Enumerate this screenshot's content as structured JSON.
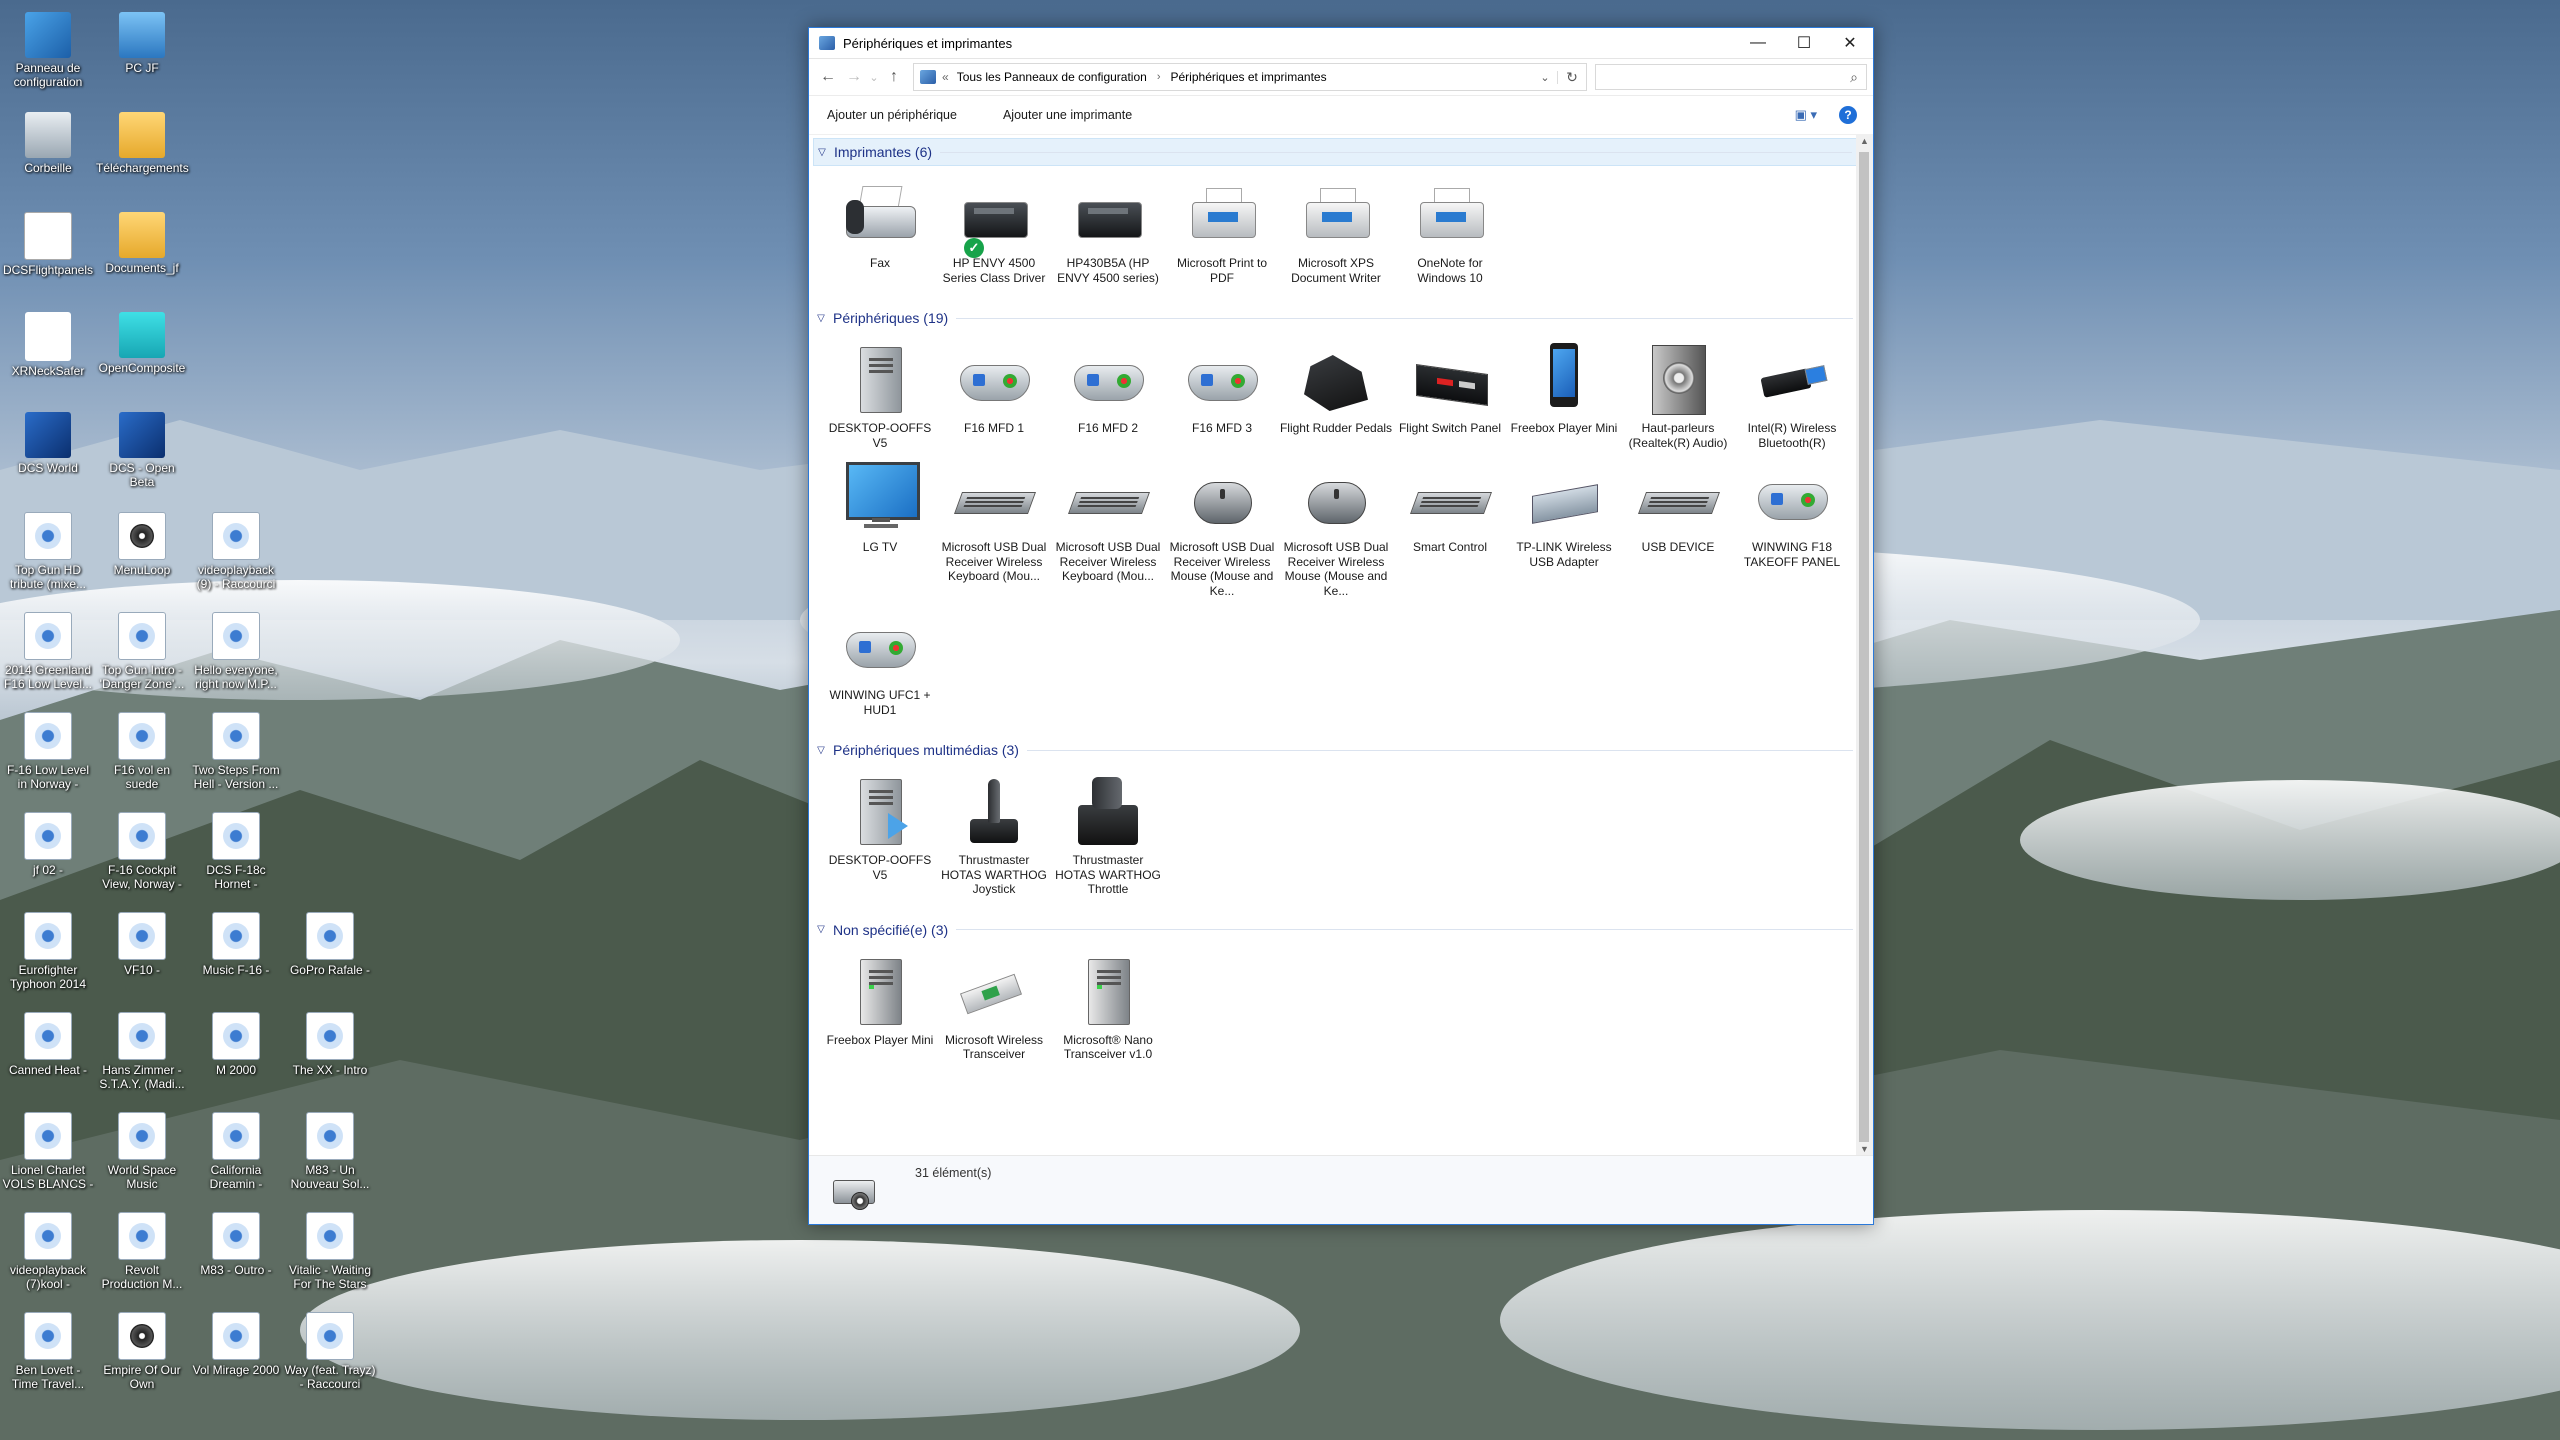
{
  "desktop": {
    "icons": [
      {
        "label": "Panneau de configuration",
        "kind": "control-panel-icon"
      },
      {
        "label": "PC JF",
        "kind": "computer-icon"
      },
      {
        "label": "Corbeille",
        "kind": "recycle-bin-icon"
      },
      {
        "label": "Téléchargements",
        "kind": "folder-icon"
      },
      {
        "label": "DCSFlightpanels",
        "kind": "app-icon"
      },
      {
        "label": "Documents_jf",
        "kind": "folder-icon"
      },
      {
        "label": "XRNeckSafer",
        "kind": "app-icon"
      },
      {
        "label": "OpenComposite",
        "kind": "app-icon"
      },
      {
        "label": "DCS World",
        "kind": "dcs-icon"
      },
      {
        "label": "DCS - Open Beta",
        "kind": "dcs-icon"
      },
      {
        "label": "Top Gun HD tribute (mixe...",
        "kind": "media-file-icon"
      },
      {
        "label": "MenuLoop",
        "kind": "audio-file-icon"
      },
      {
        "label": "videoplayback (9) - Raccourci",
        "kind": "media-file-icon"
      },
      {
        "label": "2014 Greenland F16 Low Level...",
        "kind": "media-file-icon"
      },
      {
        "label": "Top Gun Intro - 'Danger Zone'...",
        "kind": "media-file-icon"
      },
      {
        "label": "Hello everyone, right now M.P...",
        "kind": "media-file-icon"
      },
      {
        "label": "F-16 Low Level in Norway -",
        "kind": "media-file-icon"
      },
      {
        "label": "F16 vol en suede",
        "kind": "media-file-icon"
      },
      {
        "label": "Two Steps From Hell - Version ...",
        "kind": "media-file-icon"
      },
      {
        "label": "jf 02 -",
        "kind": "media-file-icon"
      },
      {
        "label": "F-16 Cockpit View, Norway -",
        "kind": "media-file-icon"
      },
      {
        "label": "DCS F-18c Hornet -",
        "kind": "media-file-icon"
      },
      {
        "label": "Eurofighter Typhoon 2014",
        "kind": "media-file-icon"
      },
      {
        "label": "VF10 -",
        "kind": "media-file-icon"
      },
      {
        "label": "Music F-16 -",
        "kind": "media-file-icon"
      },
      {
        "label": "GoPro Rafale -",
        "kind": "media-file-icon"
      },
      {
        "label": "Canned Heat -",
        "kind": "media-file-icon"
      },
      {
        "label": "Hans Zimmer - S.T.A.Y. (Madi...",
        "kind": "media-file-icon"
      },
      {
        "label": "M 2000",
        "kind": "media-file-icon"
      },
      {
        "label": "The XX - Intro",
        "kind": "media-file-icon"
      },
      {
        "label": "Lionel Charlet VOLS BLANCS -",
        "kind": "media-file-icon"
      },
      {
        "label": "World Space Music",
        "kind": "media-file-icon"
      },
      {
        "label": "California Dreamin -",
        "kind": "media-file-icon"
      },
      {
        "label": "M83 - Un Nouveau Sol...",
        "kind": "media-file-icon"
      },
      {
        "label": "videoplayback (7)kool -",
        "kind": "media-file-icon"
      },
      {
        "label": "Revolt Production M...",
        "kind": "media-file-icon"
      },
      {
        "label": "M83 - Outro -",
        "kind": "media-file-icon"
      },
      {
        "label": "Vitalic - Waiting For The Stars",
        "kind": "media-file-icon"
      },
      {
        "label": "Ben Lovett - Time Travel...",
        "kind": "media-file-icon"
      },
      {
        "label": "Empire Of Our Own",
        "kind": "audio-file-icon"
      },
      {
        "label": "Vol Mirage 2000",
        "kind": "media-file-icon"
      },
      {
        "label": "Way (feat. Trayz) - Raccourci",
        "kind": "media-file-icon"
      }
    ]
  },
  "window": {
    "title": "Périphériques et imprimantes",
    "controls": {
      "minimize": "—",
      "maximize": "☐",
      "close": "✕"
    },
    "nav": {
      "back": "←",
      "forward": "→",
      "recent": "⌄",
      "up": "↑"
    },
    "address": {
      "prefix": "«",
      "crumbs": [
        "Tous les Panneaux de configuration",
        "Périphériques et imprimantes"
      ],
      "separator": "›",
      "dropdown": "⌄",
      "refresh": "↻"
    },
    "search": {
      "placeholder": "",
      "icon": "⌕"
    },
    "commands": {
      "add_device": "Ajouter un périphérique",
      "add_printer": "Ajouter une imprimante",
      "view": "▣ ▾",
      "help": "?"
    },
    "groups": {
      "printers": {
        "header": "Imprimantes (6)",
        "items": [
          {
            "label": "Fax",
            "icon": "fax"
          },
          {
            "label": "HP ENVY 4500 Series Class Driver",
            "icon": "printer-dark",
            "default": true
          },
          {
            "label": "HP430B5A (HP ENVY 4500 series)",
            "icon": "printer-dark"
          },
          {
            "label": "Microsoft Print to PDF",
            "icon": "printer"
          },
          {
            "label": "Microsoft XPS Document Writer",
            "icon": "printer"
          },
          {
            "label": "OneNote for Windows 10",
            "icon": "printer"
          }
        ]
      },
      "devices": {
        "header": "Périphériques (19)",
        "items": [
          {
            "label": "DESKTOP-OOFFS V5",
            "icon": "tower"
          },
          {
            "label": "F16 MFD 1",
            "icon": "gamepad"
          },
          {
            "label": "F16 MFD 2",
            "icon": "gamepad"
          },
          {
            "label": "F16 MFD 3",
            "icon": "gamepad"
          },
          {
            "label": "Flight Rudder Pedals",
            "icon": "pedals"
          },
          {
            "label": "Flight Switch Panel",
            "icon": "switch-panel"
          },
          {
            "label": "Freebox Player Mini",
            "icon": "phone"
          },
          {
            "label": "Haut-parleurs (Realtek(R) Audio)",
            "icon": "speaker"
          },
          {
            "label": "Intel(R) Wireless Bluetooth(R)",
            "icon": "usb-dongle-blue"
          },
          {
            "label": "LG TV",
            "icon": "monitor"
          },
          {
            "label": "Microsoft USB Dual Receiver Wireless Keyboard (Mou...",
            "icon": "keyboard"
          },
          {
            "label": "Microsoft USB Dual Receiver Wireless Keyboard (Mou...",
            "icon": "keyboard"
          },
          {
            "label": "Microsoft USB Dual Receiver Wireless Mouse (Mouse and Ke...",
            "icon": "mouse"
          },
          {
            "label": "Microsoft USB Dual Receiver Wireless Mouse (Mouse and Ke...",
            "icon": "mouse"
          },
          {
            "label": "Smart Control",
            "icon": "keyboard"
          },
          {
            "label": "TP-LINK Wireless USB Adapter",
            "icon": "adapter"
          },
          {
            "label": "USB DEVICE",
            "icon": "keyboard"
          },
          {
            "label": "WINWING F18 TAKEOFF PANEL",
            "icon": "gamepad"
          },
          {
            "label": "WINWING UFC1 + HUD1",
            "icon": "gamepad"
          }
        ]
      },
      "multimedia": {
        "header": "Périphériques multimédias (3)",
        "items": [
          {
            "label": "DESKTOP-OOFFS V5",
            "icon": "tower-play"
          },
          {
            "label": "Thrustmaster HOTAS WARTHOG Joystick",
            "icon": "joystick"
          },
          {
            "label": "Thrustmaster HOTAS WARTHOG Throttle",
            "icon": "throttle"
          }
        ]
      },
      "unspecified": {
        "header": "Non spécifié(e) (3)",
        "items": [
          {
            "label": "Freebox Player Mini",
            "icon": "tower-dark"
          },
          {
            "label": "Microsoft Wireless Transceiver",
            "icon": "transceiver"
          },
          {
            "label": "Microsoft® Nano Transceiver v1.0",
            "icon": "tower-dark"
          }
        ]
      }
    },
    "status": {
      "count": "31 élément(s)"
    }
  }
}
